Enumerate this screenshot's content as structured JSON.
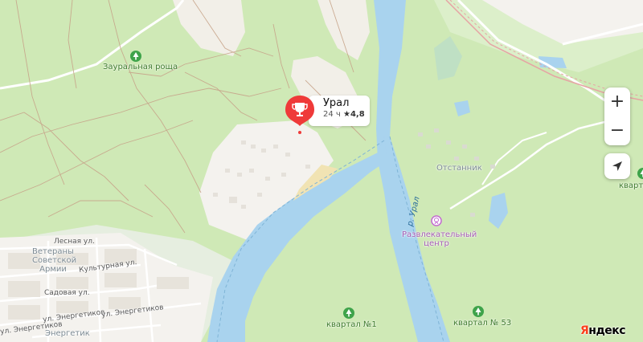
{
  "map": {
    "colors": {
      "forest": "#cfe9b6",
      "water": "#a9d3ee",
      "sand": "#f2efe8",
      "urban": "#f4f2ee",
      "road": "#ffffff",
      "path": "#c7a48a",
      "rail": "#e6a4a4",
      "accent": "#ef3a39"
    },
    "parks": [
      {
        "label": "Зауральная роща",
        "icon": "tree-icon"
      },
      {
        "label": "квартал №1",
        "icon": "tree-icon"
      },
      {
        "label": "квартал № 53",
        "icon": "tree-icon"
      },
      {
        "label": "квартал",
        "icon": "tree-icon"
      }
    ],
    "streets": [
      "Лесная ул.",
      "Культурная ул.",
      "Садовая ул.",
      "ул. Энергетиков",
      "ул. Энергетиков"
    ],
    "districts": [
      "Ветераны Советской Армии",
      "Энергетик",
      "Отстанник"
    ],
    "river_label": "р. Урал",
    "poi": {
      "label_line1": "Развлекательный",
      "label_line2": "центр",
      "icon": "ferris-wheel-icon"
    },
    "place": {
      "name": "Урал",
      "hours": "24 ч",
      "rating": "4,8",
      "icon": "trophy-icon"
    }
  },
  "controls": {
    "zoom_in": "+",
    "zoom_out": "−",
    "locate_icon": "location-arrow-icon"
  },
  "logo": {
    "first": "Я",
    "rest": "ндекс"
  }
}
